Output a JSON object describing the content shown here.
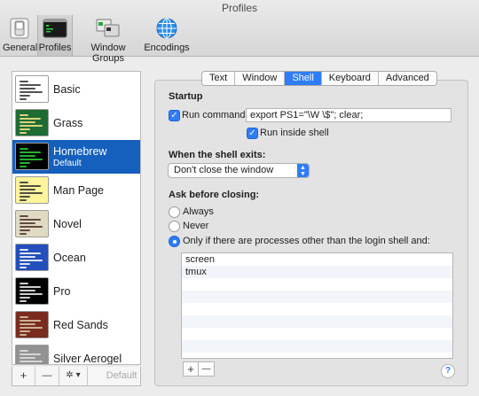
{
  "window": {
    "title": "Profiles"
  },
  "toolbar": {
    "items": [
      {
        "label": "General",
        "icon": "general-switch-icon"
      },
      {
        "label": "Profiles",
        "icon": "terminal-profile-icon",
        "selected": true
      },
      {
        "label": "Window Groups",
        "icon": "window-groups-icon"
      },
      {
        "label": "Encodings",
        "icon": "globe-icon"
      }
    ]
  },
  "sidebar": {
    "profiles": [
      {
        "name": "Basic",
        "bg": "#ffffff",
        "fg": "#333333"
      },
      {
        "name": "Grass",
        "bg": "#1e6b34",
        "fg": "#f7e889"
      },
      {
        "name": "Homebrew",
        "subtitle": "Default",
        "bg": "#000000",
        "fg": "#29d13a",
        "selected": true
      },
      {
        "name": "Man Page",
        "bg": "#fef49c",
        "fg": "#333333"
      },
      {
        "name": "Novel",
        "bg": "#dfdbc3",
        "fg": "#4d2f2d"
      },
      {
        "name": "Ocean",
        "bg": "#224fbc",
        "fg": "#ffffff"
      },
      {
        "name": "Pro",
        "bg": "#000000",
        "fg": "#f2f2f2"
      },
      {
        "name": "Red Sands",
        "bg": "#7a2a1f",
        "fg": "#d7c9a7"
      },
      {
        "name": "Silver Aerogel",
        "bg": "#929292",
        "fg": "#e0e0e0"
      }
    ],
    "add_label": "+",
    "remove_label": "—",
    "gear_label": "✲ ▾",
    "default_label": "Default"
  },
  "tabs": [
    {
      "label": "Text"
    },
    {
      "label": "Window"
    },
    {
      "label": "Shell",
      "active": true
    },
    {
      "label": "Keyboard"
    },
    {
      "label": "Advanced"
    }
  ],
  "startup": {
    "heading": "Startup",
    "run_command_label": "Run command:",
    "run_command_checked": true,
    "command_value": "export PS1=\"\\W \\$\"; clear;",
    "run_inside_shell_label": "Run inside shell",
    "run_inside_shell_checked": true
  },
  "shell_exit": {
    "heading": "When the shell exits:",
    "selected_option": "Don't close the window"
  },
  "ask_before_closing": {
    "heading": "Ask before closing:",
    "options": [
      {
        "label": "Always",
        "selected": false
      },
      {
        "label": "Never",
        "selected": false
      },
      {
        "label": "Only if there are processes other than the login shell and:",
        "selected": true
      }
    ],
    "processes": [
      "screen",
      "tmux"
    ],
    "add_label": "+",
    "remove_label": "—"
  },
  "help_label": "?",
  "colors": {
    "accent": "#2f7df6",
    "selection": "#1560bd"
  }
}
